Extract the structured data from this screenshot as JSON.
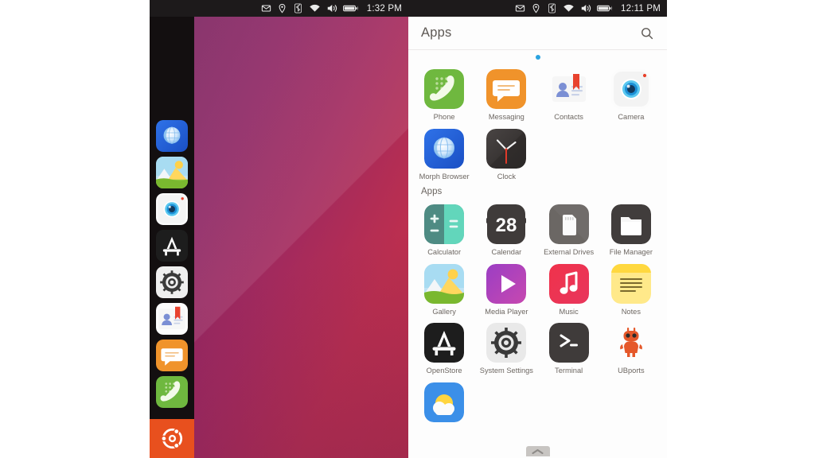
{
  "statusbar_left": {
    "time": "1:32 PM",
    "icons": [
      "mail-icon",
      "location-icon",
      "bluetooth-icon",
      "wifi-icon",
      "volume-icon",
      "battery-icon"
    ]
  },
  "statusbar_right": {
    "time": "12:11 PM",
    "icons": [
      "mail-icon",
      "location-icon",
      "bluetooth-icon",
      "wifi-icon",
      "volume-icon",
      "battery-icon"
    ]
  },
  "launcher": {
    "items": [
      {
        "name": "morph-browser",
        "label": "Morph Browser"
      },
      {
        "name": "gallery",
        "label": "Gallery"
      },
      {
        "name": "camera",
        "label": "Camera"
      },
      {
        "name": "openstore",
        "label": "OpenStore"
      },
      {
        "name": "system-settings",
        "label": "System Settings"
      },
      {
        "name": "contacts",
        "label": "Contacts"
      },
      {
        "name": "messaging",
        "label": "Messaging"
      },
      {
        "name": "phone",
        "label": "Phone"
      }
    ],
    "home_label": "Ubuntu"
  },
  "drawer": {
    "title": "Apps",
    "search_icon": "search-icon",
    "page_dots": 1,
    "active_dot": 0,
    "recent": [
      {
        "name": "phone",
        "label": "Phone"
      },
      {
        "name": "messaging",
        "label": "Messaging"
      },
      {
        "name": "contacts",
        "label": "Contacts"
      },
      {
        "name": "camera",
        "label": "Camera"
      },
      {
        "name": "morph-browser",
        "label": "Morph Browser"
      },
      {
        "name": "clock",
        "label": "Clock"
      }
    ],
    "section_label": "Apps",
    "apps": [
      {
        "name": "calculator",
        "label": "Calculator"
      },
      {
        "name": "calendar",
        "label": "Calendar",
        "badge": "28"
      },
      {
        "name": "external-drives",
        "label": "External Drives"
      },
      {
        "name": "file-manager",
        "label": "File Manager"
      },
      {
        "name": "gallery",
        "label": "Gallery"
      },
      {
        "name": "media-player",
        "label": "Media Player"
      },
      {
        "name": "music",
        "label": "Music"
      },
      {
        "name": "notes",
        "label": "Notes"
      },
      {
        "name": "openstore",
        "label": "OpenStore"
      },
      {
        "name": "system-settings",
        "label": "System Settings"
      },
      {
        "name": "terminal",
        "label": "Terminal"
      },
      {
        "name": "ubports",
        "label": "UBports"
      }
    ],
    "partial_row": [
      {
        "name": "weather",
        "label": ""
      }
    ],
    "bottom_handle": "chevron-up-icon"
  },
  "colors": {
    "accent_dot": "#2aa3e0",
    "ubuntu_orange": "#e8501e",
    "statusbar_bg": "#1d1a1b",
    "launcher_bg": "#130f10",
    "drawer_bg": "#fdfdfd",
    "wallpaper_purple": "#7e2360",
    "wallpaper_red": "#c3304a"
  }
}
